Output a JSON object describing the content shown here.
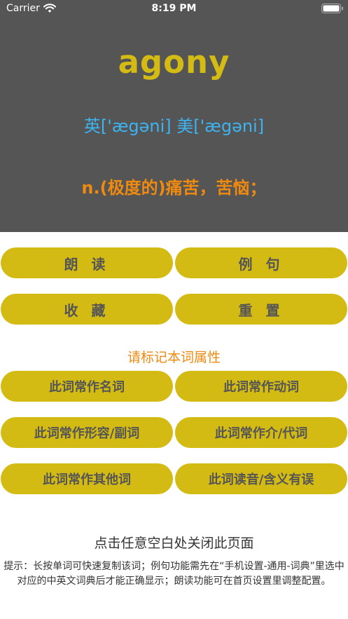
{
  "status_bar": {
    "carrier": "Carrier",
    "time": "8:19 PM",
    "wifi_icon": "wifi-icon",
    "battery_icon": "battery-icon"
  },
  "word_card": {
    "word": "agony",
    "phonetic": "英['ægəni] 美['ægəni]",
    "meaning": "n.(极度的)痛苦，苦恼；"
  },
  "actions": {
    "read_aloud": "朗 读",
    "example": "例 句",
    "favorite": "收 藏",
    "reset": "重 置"
  },
  "attributes": {
    "title": "请标记本词属性",
    "noun": "此词常作名词",
    "verb": "此词常作动词",
    "adj_adv": "此词常作形容/副词",
    "prep_pron": "此词常作介/代词",
    "other": "此词常作其他词",
    "error": "此词读音/含义有误"
  },
  "footer": {
    "close_hint": "点击任意空白处关闭此页面",
    "tip": "提示：长按单词可快速复制该词；例句功能需先在“手机设置-通用-词典”里选中对应的中英文词典后才能正确显示；朗读功能可在首页设置里调整配置。"
  },
  "colors": {
    "panel_bg": "#555555",
    "accent_yellow": "#d4bb14",
    "phonetic_blue": "#3db4f0",
    "meaning_orange": "#ee8a10"
  }
}
